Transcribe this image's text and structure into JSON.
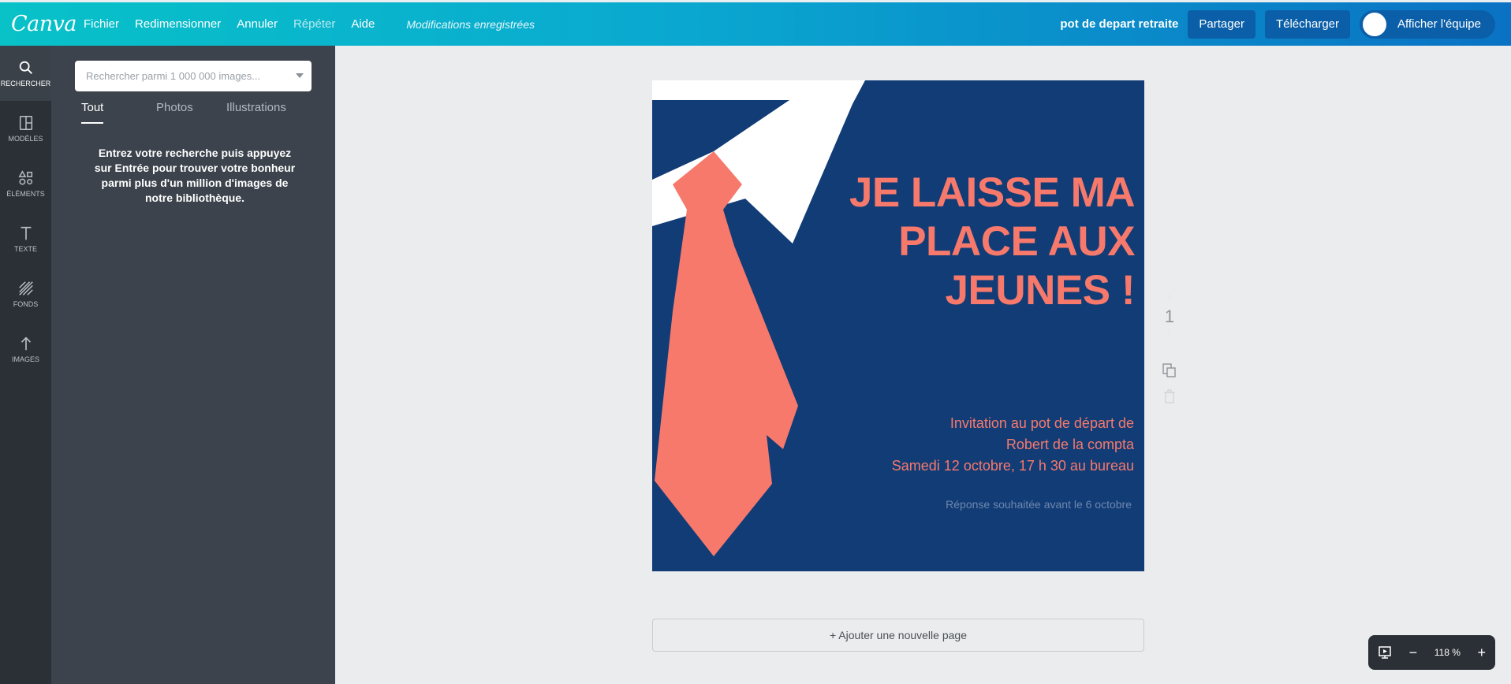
{
  "app": {
    "logo": "Canva"
  },
  "menu": {
    "file": "Fichier",
    "resize": "Redimensionner",
    "undo": "Annuler",
    "redo": "Répéter",
    "help": "Aide",
    "saved_status": "Modifications enregistrées"
  },
  "header": {
    "doc_title": "pot de depart retraite",
    "share": "Partager",
    "download": "Télécharger",
    "team": "Afficher l'équipe"
  },
  "rail": [
    {
      "label": "RECHERCHER",
      "icon": "search-icon"
    },
    {
      "label": "MODÈLES",
      "icon": "layout-icon"
    },
    {
      "label": "ÉLÉMENTS",
      "icon": "shapes-icon"
    },
    {
      "label": "TEXTE",
      "icon": "text-icon"
    },
    {
      "label": "FONDS",
      "icon": "background-icon"
    },
    {
      "label": "IMAGES",
      "icon": "upload-icon"
    }
  ],
  "panel": {
    "search_placeholder": "Rechercher parmi 1 000 000 images...",
    "tabs": [
      "Tout",
      "Photos",
      "Illustrations"
    ],
    "message": "Entrez votre recherche puis appuyez sur Entrée pour trouver votre bonheur parmi plus d'un million d'images de notre bibliothèque."
  },
  "design": {
    "headline": [
      "JE LAISSE MA",
      "PLACE AUX",
      "JEUNES !"
    ],
    "invite": [
      "Invitation au pot de départ de",
      "Robert de la compta",
      "Samedi 12 octobre, 17 h 30 au bureau"
    ],
    "reply": "Réponse souhaitée avant le 6 octobre",
    "colors": {
      "background": "#113c76",
      "accent": "#f7796c",
      "collar": "#ffffff"
    }
  },
  "page": {
    "number": "1"
  },
  "add_page": "+ Ajouter une nouvelle page",
  "zoom": {
    "value": "118 %"
  }
}
